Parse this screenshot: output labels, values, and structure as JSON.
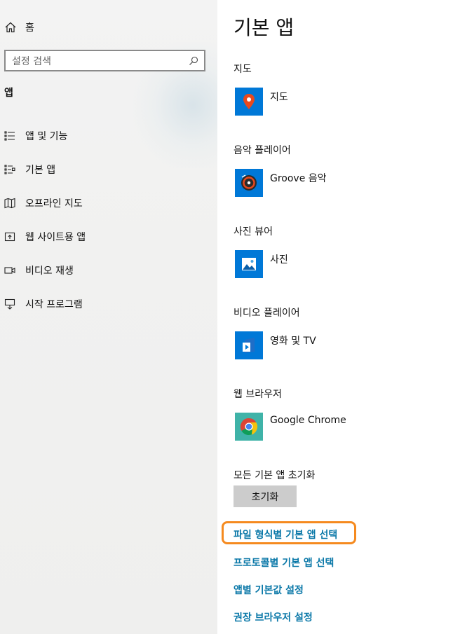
{
  "nav": {
    "home_label": "홈",
    "search_placeholder": "설정 검색",
    "section_label": "앱",
    "items": [
      {
        "label": "앱 및 기능",
        "icon": "apps-features-icon"
      },
      {
        "label": "기본 앱",
        "icon": "default-apps-icon"
      },
      {
        "label": "오프라인 지도",
        "icon": "offline-maps-icon"
      },
      {
        "label": "웹 사이트용 앱",
        "icon": "apps-for-websites-icon"
      },
      {
        "label": "비디오 재생",
        "icon": "video-playback-icon"
      },
      {
        "label": "시작 프로그램",
        "icon": "startup-icon"
      }
    ]
  },
  "main": {
    "title": "기본 앱",
    "categories": [
      {
        "label": "지도",
        "app": "지도",
        "icon": "maps-app-icon"
      },
      {
        "label": "음악 플레이어",
        "app": "Groove 음악",
        "icon": "groove-music-icon"
      },
      {
        "label": "사진 뷰어",
        "app": "사진",
        "icon": "photos-app-icon"
      },
      {
        "label": "비디오 플레이어",
        "app": "영화 및 TV",
        "icon": "movies-tv-icon"
      },
      {
        "label": "웹 브라우저",
        "app": "Google Chrome",
        "icon": "chrome-icon"
      }
    ],
    "reset_label": "모든 기본 앱 초기화",
    "reset_button": "초기화",
    "links": [
      "파일 형식별 기본 앱 선택",
      "프로토콜별 기본 앱 선택",
      "앱별 기본값 설정",
      "권장 브라우저 설정"
    ]
  },
  "colors": {
    "tile_blue": "#0078d7",
    "link": "#0a78a8",
    "highlight": "#f58a1f",
    "button_bg": "#cccccc"
  }
}
